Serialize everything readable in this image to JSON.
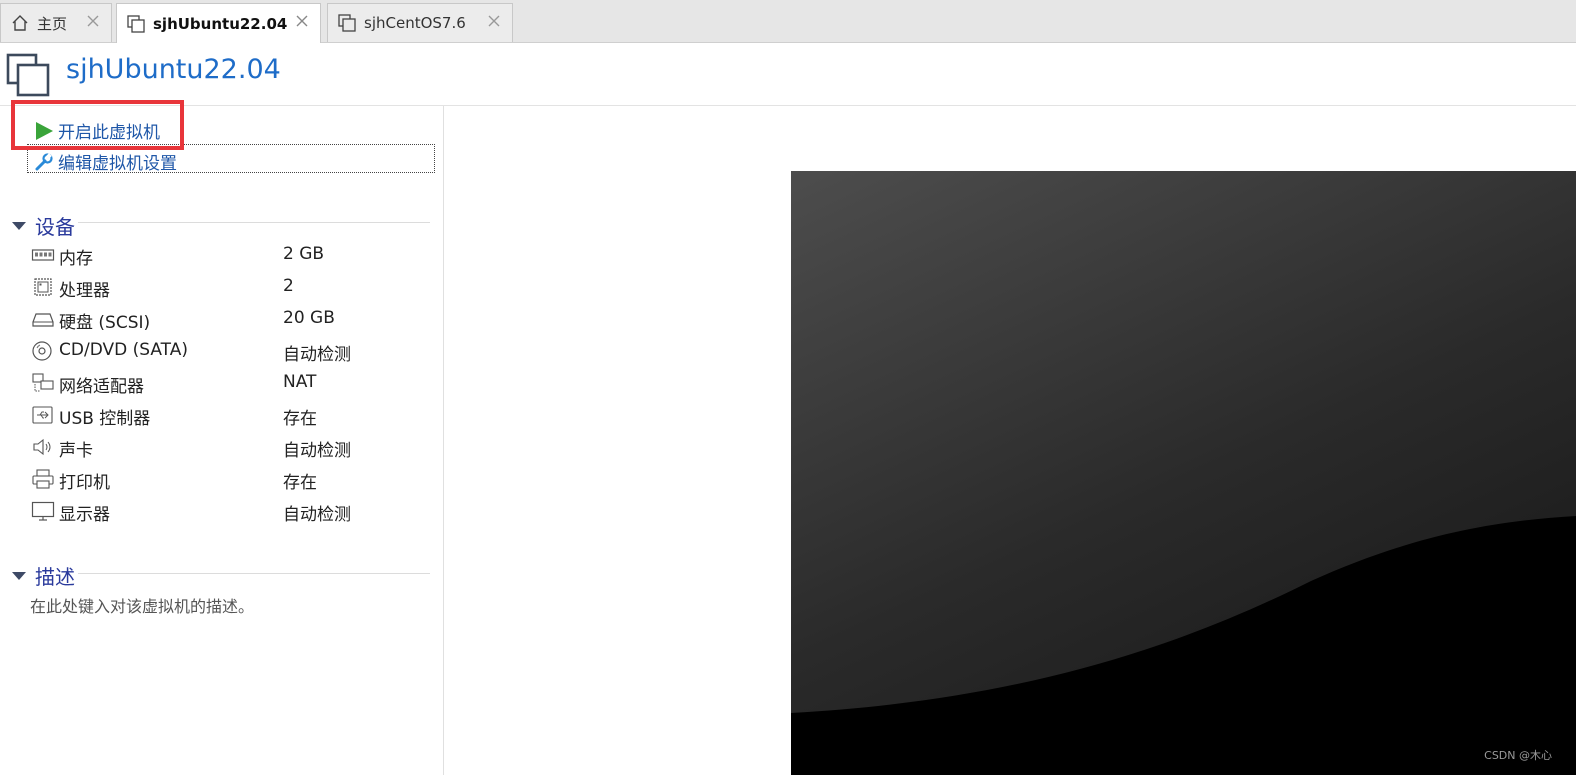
{
  "tabs": [
    {
      "label": "主页",
      "icon": "home-icon",
      "active": false
    },
    {
      "label": "sjhUbuntu22.04",
      "icon": "vm-icon",
      "active": true
    },
    {
      "label": "sjhCentOS7.6",
      "icon": "vm-icon",
      "active": false
    }
  ],
  "vm": {
    "title": "sjhUbuntu22.04"
  },
  "actions": {
    "power_on": "开启此虚拟机",
    "edit_settings": "编辑虚拟机设置"
  },
  "devices": {
    "heading": "设备",
    "items": [
      {
        "name": "内存",
        "value": "2 GB",
        "icon": "memory-icon"
      },
      {
        "name": "处理器",
        "value": "2",
        "icon": "processor-icon"
      },
      {
        "name": "硬盘 (SCSI)",
        "value": "20 GB",
        "icon": "hard-disk-icon"
      },
      {
        "name": "CD/DVD (SATA)",
        "value": "自动检测",
        "icon": "cd-dvd-icon"
      },
      {
        "name": "网络适配器",
        "value": "NAT",
        "icon": "network-adapter-icon"
      },
      {
        "name": "USB 控制器",
        "value": "存在",
        "icon": "usb-icon"
      },
      {
        "name": "声卡",
        "value": "自动检测",
        "icon": "speaker-icon"
      },
      {
        "name": "打印机",
        "value": "存在",
        "icon": "printer-icon"
      },
      {
        "name": "显示器",
        "value": "自动检测",
        "icon": "monitor-icon"
      }
    ]
  },
  "description": {
    "heading": "描述",
    "placeholder": "在此处键入对该虚拟机的描述。"
  },
  "watermark": "CSDN @木心",
  "colors": {
    "title_blue": "#1e6cc8",
    "section_purple": "#2a3a9c",
    "highlight_red": "#e8353a",
    "play_green": "#3aa43a"
  }
}
